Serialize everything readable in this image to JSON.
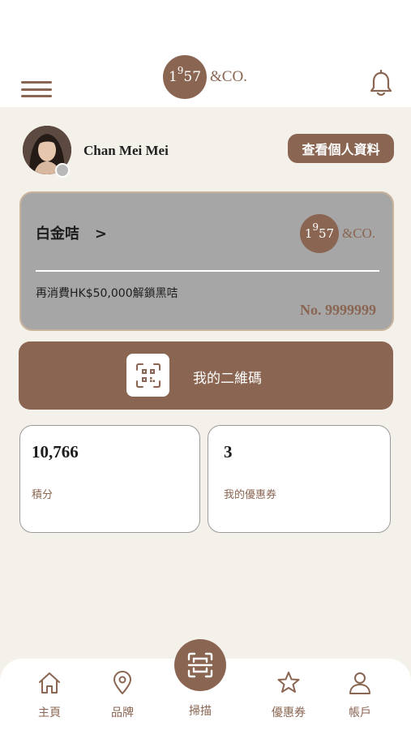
{
  "header": {
    "logo_number": "1957",
    "logo_number_main": "1",
    "logo_number_sup": "9",
    "logo_number_tail": "57",
    "logo_suffix": "&CO.",
    "menu_icon": "hamburger-icon",
    "notification_icon": "bell-icon"
  },
  "profile": {
    "name": "Chan Mei Mei",
    "view_profile_label": "查看個人資料"
  },
  "membership": {
    "tier_name": "白金咭",
    "tier_arrow": ">",
    "progress_text": "再消費HK$50,000解鎖黑咭",
    "member_no": "No. 9999999"
  },
  "qr": {
    "label": "我的二維碼",
    "icon": "qr-code-icon"
  },
  "stats": {
    "points_value": "10,766",
    "points_label": "積分",
    "coupons_value": "3",
    "coupons_label": "我的優惠券"
  },
  "nav": {
    "home_label": "主頁",
    "brand_label": "品牌",
    "scan_label": "掃描",
    "coupons_label": "優惠券",
    "account_label": "帳戶"
  },
  "colors": {
    "brand": "#8a6552",
    "background": "#f4f1ea",
    "tier_card": "#a6a6a6"
  }
}
